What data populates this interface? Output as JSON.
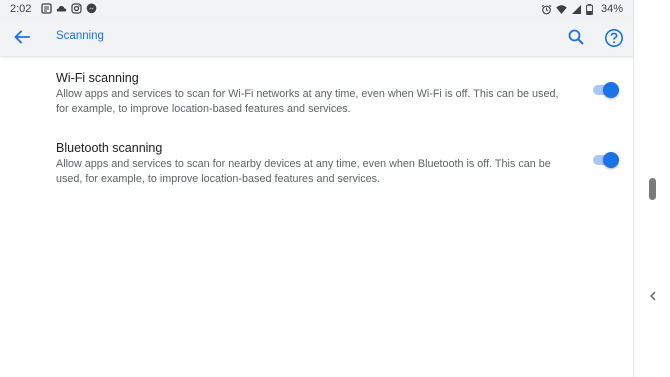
{
  "status_bar": {
    "time": "2:02",
    "left_icons": [
      "notes-icon",
      "cloud-icon",
      "instagram-icon",
      "messenger-icon"
    ],
    "right_icons": [
      "alarm-icon",
      "wifi-icon",
      "signal-icon",
      "battery-icon"
    ],
    "battery": "34%"
  },
  "app_bar": {
    "title": "Scanning",
    "accent_color": "#1a73e8",
    "actions": [
      "search-icon",
      "help-icon"
    ]
  },
  "settings": [
    {
      "title": "Wi-Fi scanning",
      "summary_line1": "Allow apps and services to scan for Wi-Fi networks at any time, even when Wi-Fi is off. This can be used,",
      "summary_line2": "for example, to improve location-based features and services.",
      "enabled": true
    },
    {
      "title": "Bluetooth scanning",
      "summary_line1": "Allow apps and services to scan for nearby devices at any time, even when Bluetooth is off. This can be",
      "summary_line2": "used, for example, to improve location-based features and services.",
      "enabled": true
    }
  ]
}
